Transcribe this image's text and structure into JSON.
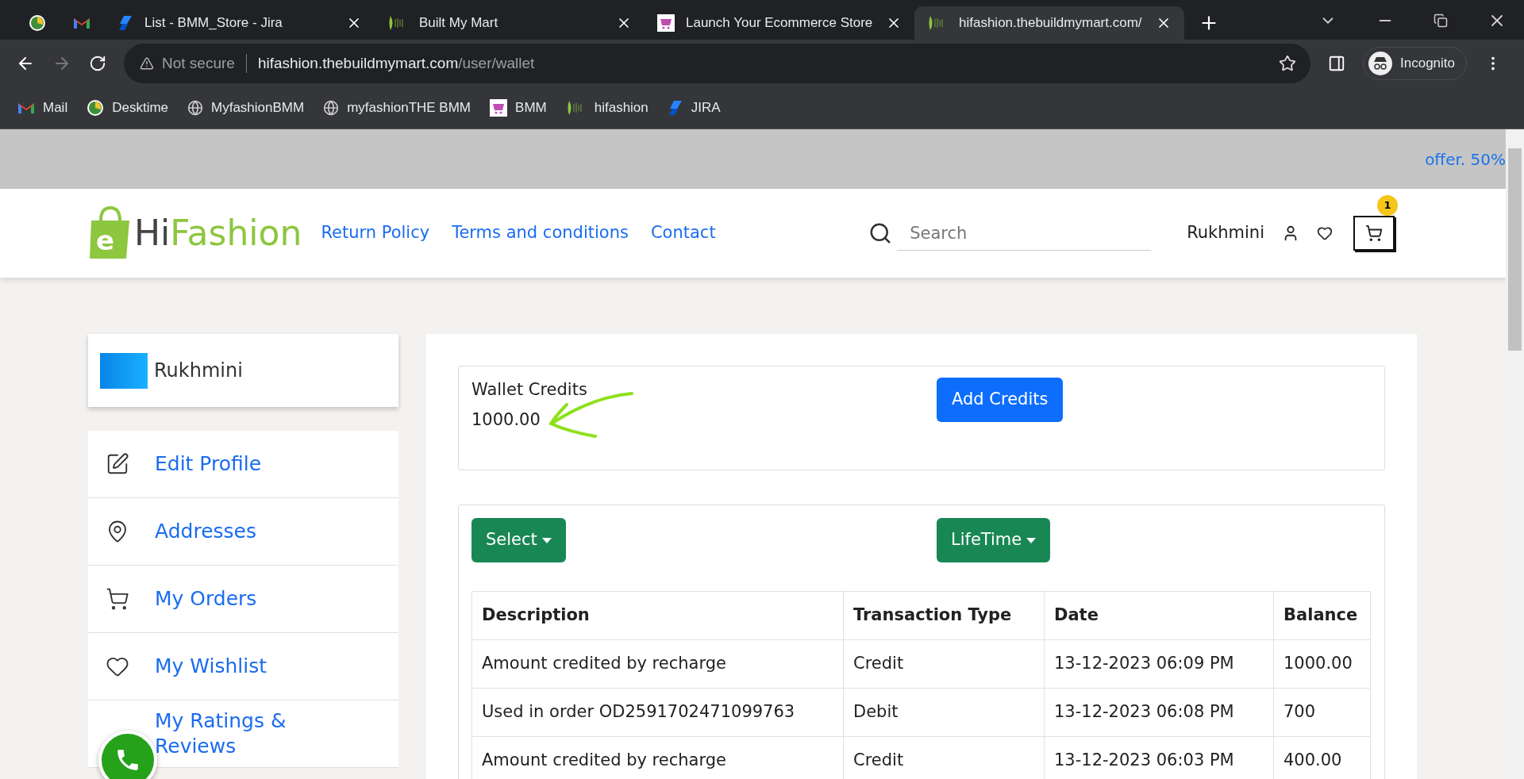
{
  "browser": {
    "tabs": [
      {
        "selected": false
      },
      {
        "selected": false
      },
      {
        "title": "List - BMM_Store - Jira",
        "selected": false
      },
      {
        "title": "Built My Mart",
        "selected": false
      },
      {
        "title": "Launch Your Ecommerce Store",
        "selected": false
      },
      {
        "title": "hifashion.thebuildmymart.com/",
        "selected": true
      }
    ],
    "address": {
      "security": "Not secure",
      "host": "hifashion.thebuildmymart.com",
      "path": "/user/wallet"
    },
    "profile": "Incognito",
    "bookmarks": [
      "Mail",
      "Desktime",
      "MyfashionBMM",
      "myfashionTHE BMM",
      "BMM",
      "hifashion",
      "JIRA"
    ]
  },
  "offer_banner": "offer. 50%",
  "header": {
    "logo": {
      "mark": "e",
      "first": "Hi",
      "second": "Fashion"
    },
    "nav": [
      "Return Policy",
      "Terms and conditions",
      "Contact"
    ],
    "search": {
      "placeholder": "Search"
    },
    "user": "Rukhmini",
    "cart_count": "1"
  },
  "sidebar": {
    "user": "Rukhmini",
    "items": [
      "Edit Profile",
      "Addresses",
      "My Orders",
      "My Wishlist",
      "My Ratings & Reviews"
    ]
  },
  "wallet": {
    "label": "Wallet Credits",
    "amount": "1000.00",
    "add_button": "Add Credits"
  },
  "filters": [
    "Select",
    "LifeTime"
  ],
  "table": {
    "columns": [
      "Description",
      "Transaction Type",
      "Date",
      "Balance"
    ],
    "rows": [
      [
        "Amount credited by recharge",
        "Credit",
        "13-12-2023 06:09 PM",
        "1000.00"
      ],
      [
        "Used in order OD2591702471099763",
        "Debit",
        "13-12-2023 06:08 PM",
        "700"
      ],
      [
        "Amount credited by recharge",
        "Credit",
        "13-12-2023 06:03 PM",
        "400.00"
      ]
    ]
  }
}
